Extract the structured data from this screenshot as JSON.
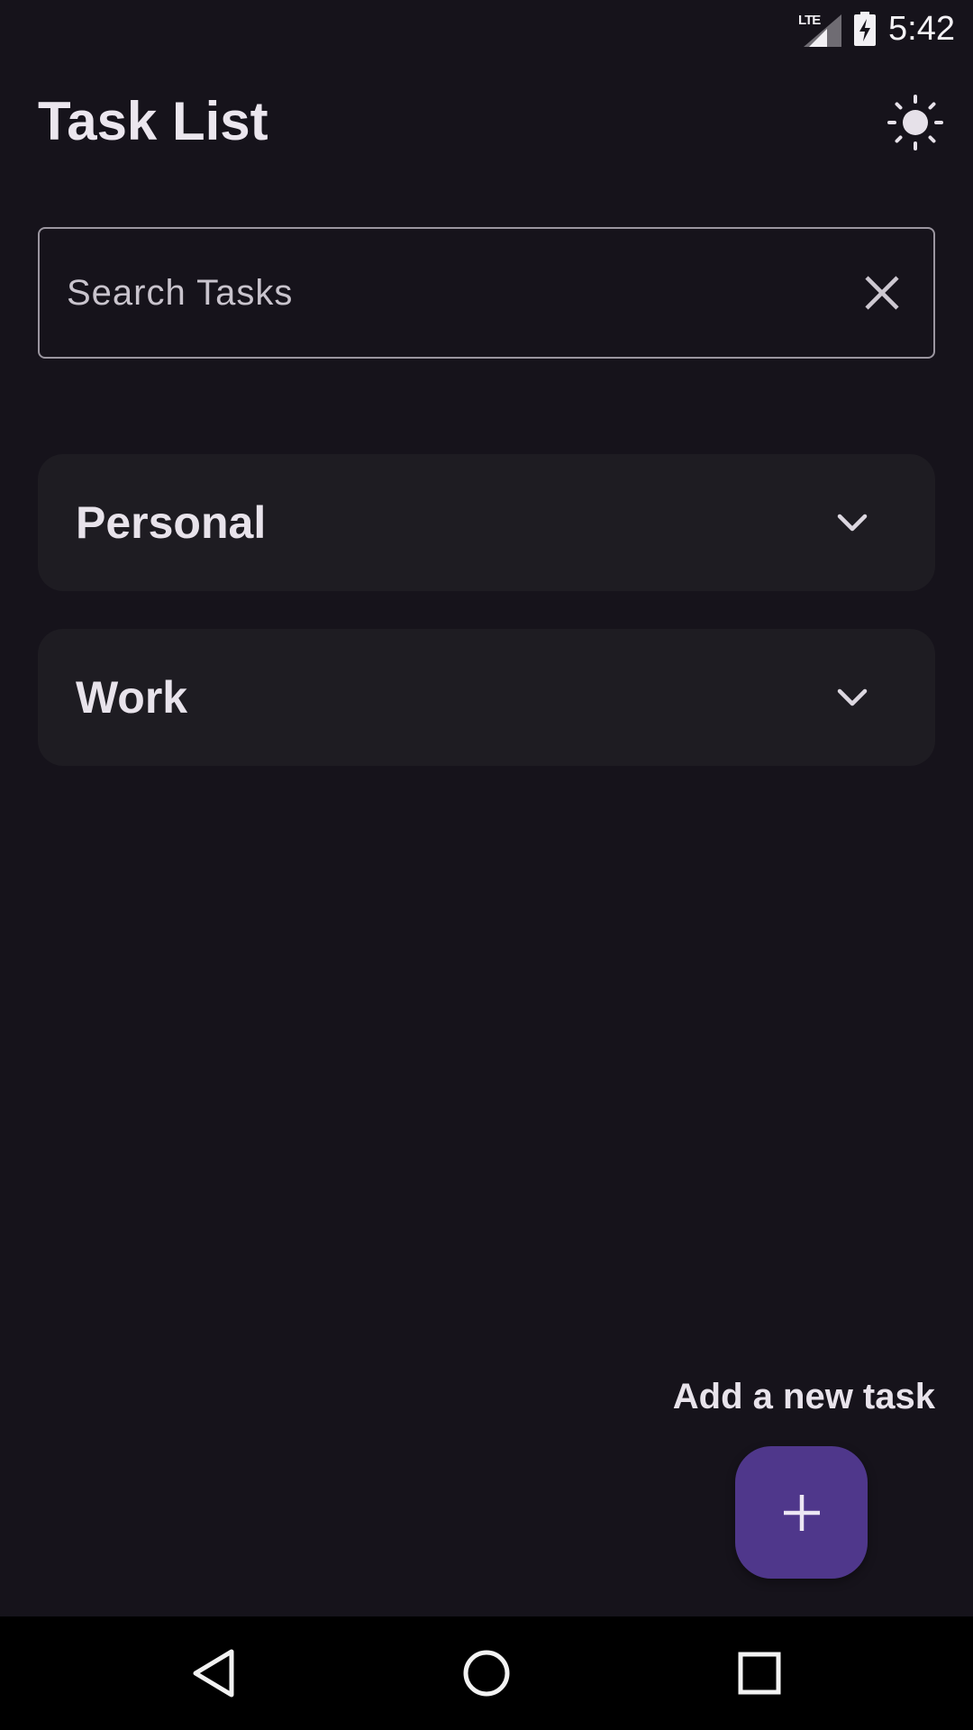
{
  "status_bar": {
    "network": "LTE",
    "time": "5:42",
    "icons": [
      "lte-icon",
      "signal-icon",
      "battery-charging-icon"
    ]
  },
  "header": {
    "title": "Task List",
    "theme_icon": "sun-icon"
  },
  "search": {
    "placeholder": "Search Tasks",
    "value": "",
    "clear_icon": "close-icon"
  },
  "categories": [
    {
      "label": "Personal",
      "icon": "chevron-down-icon"
    },
    {
      "label": "Work",
      "icon": "chevron-down-icon"
    }
  ],
  "add_task": {
    "label": "Add a new task",
    "fab_icon": "plus-icon"
  },
  "nav_bar": {
    "icons": [
      "back-icon",
      "home-icon",
      "recents-icon"
    ]
  },
  "colors": {
    "background": "#16131b",
    "card": "#1e1c22",
    "fab": "#4f378b",
    "text": "#e7e1ea"
  }
}
